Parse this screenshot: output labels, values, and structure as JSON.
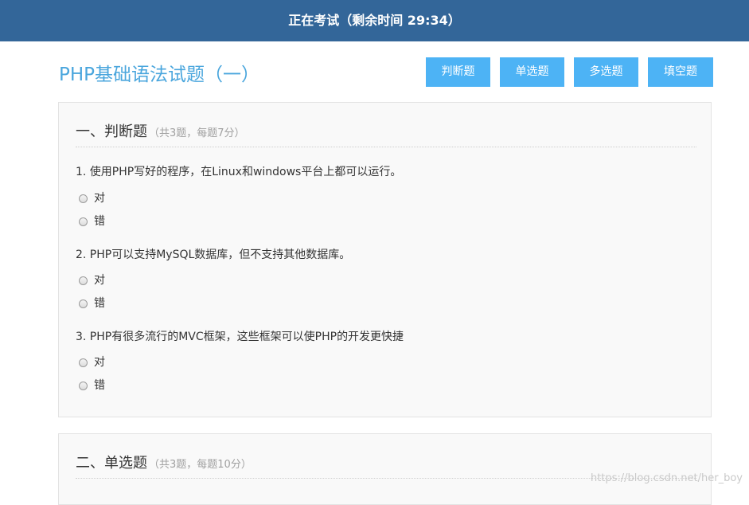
{
  "header": {
    "status": "正在考试（剩余时间 29:34）"
  },
  "exam": {
    "title": "PHP基础语法试题（一）"
  },
  "tabs": [
    {
      "label": "判断题"
    },
    {
      "label": "单选题"
    },
    {
      "label": "多选题"
    },
    {
      "label": "填空题"
    }
  ],
  "sections": [
    {
      "title": "一、判断题",
      "meta": "（共3题，每题7分）",
      "questions": [
        {
          "text": "1. 使用PHP写好的程序，在Linux和windows平台上都可以运行。",
          "options": [
            "对",
            "错"
          ]
        },
        {
          "text": "2. PHP可以支持MySQL数据库，但不支持其他数据库。",
          "options": [
            "对",
            "错"
          ]
        },
        {
          "text": "3. PHP有很多流行的MVC框架，这些框架可以使PHP的开发更快捷",
          "options": [
            "对",
            "错"
          ]
        }
      ]
    },
    {
      "title": "二、单选题",
      "meta": "（共3题，每题10分）"
    }
  ],
  "watermark": "https://blog.csdn.net/her_boy"
}
